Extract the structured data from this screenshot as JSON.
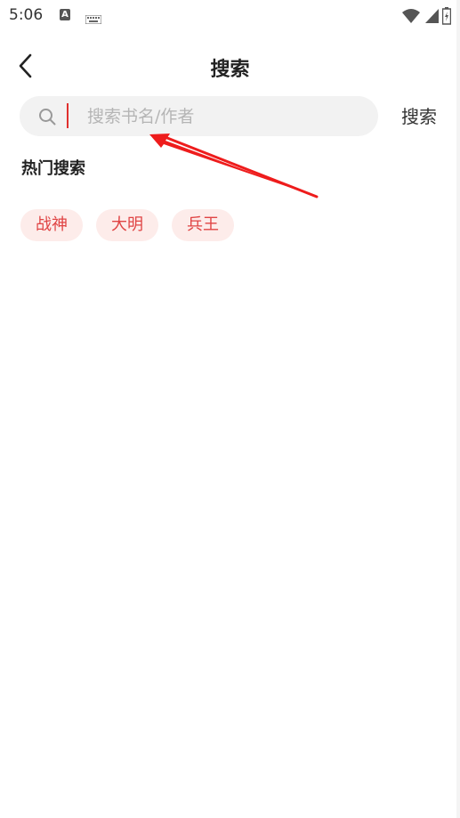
{
  "status_bar": {
    "time": "5:06",
    "icons": [
      "a-icon",
      "keyboard-icon",
      "wifi-icon",
      "signal-icon",
      "battery-icon"
    ]
  },
  "header": {
    "title": "搜索",
    "back_icon": "chevron-left-icon"
  },
  "search": {
    "placeholder": "搜索书名/作者",
    "value": "",
    "button_label": "搜索",
    "icon": "search-icon"
  },
  "hot_search": {
    "title": "热门搜索",
    "tags": [
      "战神",
      "大明",
      "兵王"
    ]
  },
  "colors": {
    "accent": "#e04444",
    "tag_bg": "#fdecea",
    "search_bg": "#f2f2f2",
    "annotation": "#ee1c1c"
  }
}
